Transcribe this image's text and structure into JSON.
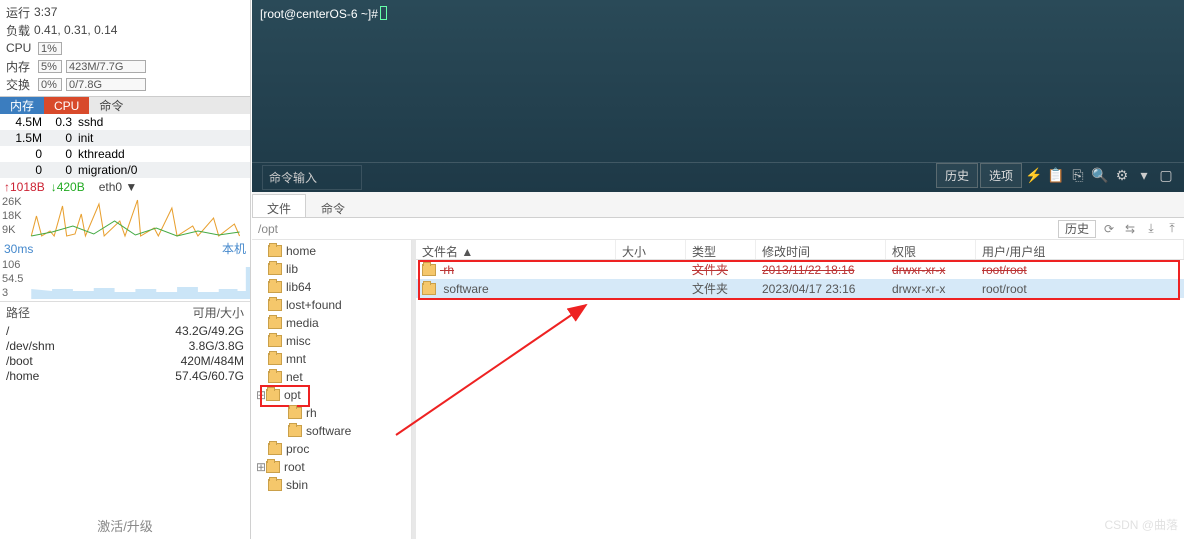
{
  "stats": {
    "run_label": "运行",
    "run_val": "3:37",
    "load_label": "负载",
    "load_val": "0.41, 0.31, 0.14",
    "cpu_label": "CPU",
    "cpu_val": "1%",
    "mem_label": "内存",
    "mem_pct": "5%",
    "mem_val": "423M/7.7G",
    "swap_label": "交换",
    "swap_pct": "0%",
    "swap_val": "0/7.8G"
  },
  "ptabs": {
    "mem": "内存",
    "cpu": "CPU",
    "cmd": "命令"
  },
  "procs": [
    {
      "m": "4.5M",
      "c": "0.3",
      "n": "sshd"
    },
    {
      "m": "1.5M",
      "c": "0",
      "n": "init"
    },
    {
      "m": "0",
      "c": "0",
      "n": "kthreadd"
    },
    {
      "m": "0",
      "c": "0",
      "n": "migration/0"
    }
  ],
  "net": {
    "up": "↑1018B",
    "dn": "↓420B",
    "if": "eth0 ▼",
    "y1": "26K",
    "y2": "18K",
    "y3": "9K"
  },
  "lat": {
    "lbl": "30ms",
    "host": "本机",
    "y1": "106",
    "y2": "54.5",
    "y3": "3"
  },
  "disk": {
    "h1": "路径",
    "h2": "可用/大小",
    "rows": [
      {
        "p": "/",
        "v": "43.2G/49.2G"
      },
      {
        "p": "/dev/shm",
        "v": "3.8G/3.8G"
      },
      {
        "p": "/boot",
        "v": "420M/484M"
      },
      {
        "p": "/home",
        "v": "57.4G/60.7G"
      }
    ]
  },
  "footer": "激活/升级",
  "term": {
    "prompt": "[root@centerOS-6 ~]#",
    "cmd_in": "命令输入",
    "hist": "历史",
    "opt": "选项"
  },
  "ftabs": {
    "file": "文件",
    "cmd": "命令"
  },
  "path": "/opt",
  "path_hist": "历史",
  "tree": [
    "home",
    "lib",
    "lib64",
    "lost+found",
    "media",
    "misc",
    "mnt",
    "net",
    "opt",
    "rh",
    "software",
    "proc",
    "root",
    "sbin"
  ],
  "cols": {
    "name": "文件名 ▲",
    "size": "大小",
    "type": "类型",
    "mtime": "修改时间",
    "perm": "权限",
    "own": "用户/用户组"
  },
  "rows": [
    {
      "n": "rh",
      "s": "",
      "t": "文件夹",
      "m": "2013/11/22 18:16",
      "p": "drwxr-xr-x",
      "o": "root/root"
    },
    {
      "n": "software",
      "s": "",
      "t": "文件夹",
      "m": "2023/04/17 23:16",
      "p": "drwxr-xr-x",
      "o": "root/root"
    }
  ],
  "wm": "CSDN @曲落"
}
